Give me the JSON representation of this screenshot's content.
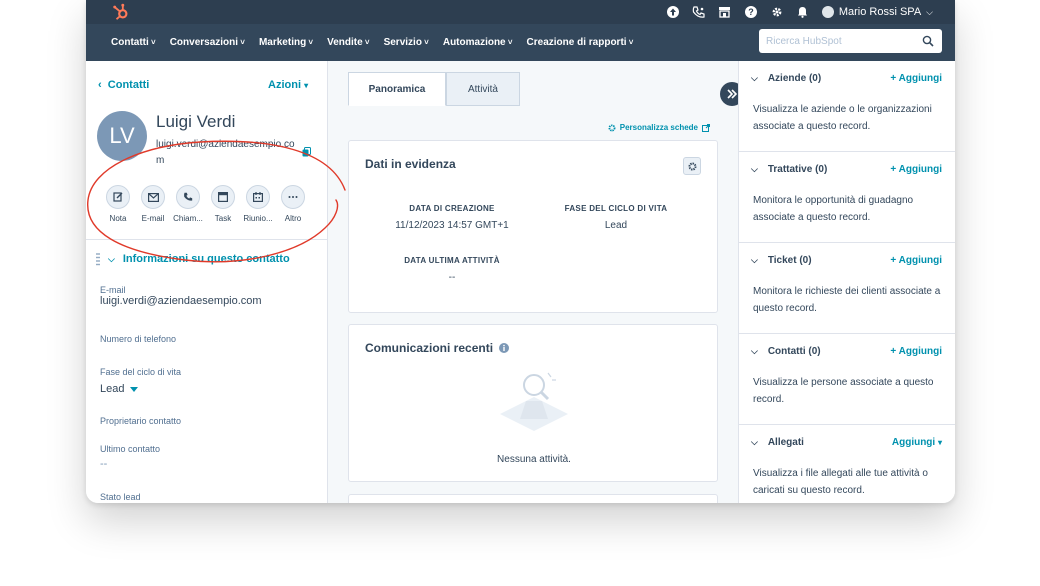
{
  "topbar": {
    "account_name": "Mario Rossi SPA",
    "icons": [
      "upgrade-icon",
      "calling-icon",
      "marketplace-icon",
      "help-icon",
      "settings-icon",
      "notifications-icon"
    ]
  },
  "nav": {
    "items": [
      "Contatti",
      "Conversazioni",
      "Marketing",
      "Vendite",
      "Servizio",
      "Automazione",
      "Creazione di rapporti"
    ],
    "search_placeholder": "Ricerca HubSpot"
  },
  "contact": {
    "back_label": "Contatti",
    "actions_label": "Azioni",
    "initials": "LV",
    "name": "Luigi Verdi",
    "email": "luigi.verdi@aziendaesempio.com",
    "quick_actions": [
      {
        "label": "Nota",
        "icon": "note-icon"
      },
      {
        "label": "E-mail",
        "icon": "email-icon"
      },
      {
        "label": "Chiam...",
        "icon": "phone-icon"
      },
      {
        "label": "Task",
        "icon": "task-icon"
      },
      {
        "label": "Riunio...",
        "icon": "meeting-icon"
      },
      {
        "label": "Altro",
        "icon": "more-icon"
      }
    ],
    "section_title": "Informazioni su questo contatto",
    "fields": [
      {
        "label": "E-mail",
        "value": "luigi.verdi@aziendaesempio.com"
      },
      {
        "label": "Numero di telefono",
        "value": ""
      },
      {
        "label": "Fase del ciclo di vita",
        "value": "Lead"
      },
      {
        "label": "Proprietario contatto",
        "value": ""
      },
      {
        "label": "Ultimo contatto",
        "value": "--"
      },
      {
        "label": "Stato lead",
        "value": ""
      }
    ]
  },
  "center": {
    "tabs": [
      "Panoramica",
      "Attività"
    ],
    "personalize_label": "Personalizza schede",
    "highlights": {
      "title": "Dati in evidenza",
      "items": [
        {
          "label": "DATA DI CREAZIONE",
          "value": "11/12/2023 14:57 GMT+1"
        },
        {
          "label": "FASE DEL CICLO DI VITA",
          "value": "Lead"
        },
        {
          "label": "DATA ULTIMA ATTIVITÀ",
          "value": "--"
        }
      ]
    },
    "recent": {
      "title": "Comunicazioni recenti",
      "empty": "Nessuna attività."
    }
  },
  "sidebar": {
    "sections": [
      {
        "title": "Aziende (0)",
        "add": "+ Aggiungi",
        "desc": "Visualizza le aziende o le organizzazioni associate a questo record."
      },
      {
        "title": "Trattative (0)",
        "add": "+ Aggiungi",
        "desc": "Monitora le opportunità di guadagno associate a questo record."
      },
      {
        "title": "Ticket (0)",
        "add": "+ Aggiungi",
        "desc": "Monitora le richieste dei clienti associate a questo record."
      },
      {
        "title": "Contatti (0)",
        "add": "+ Aggiungi",
        "desc": "Visualizza le persone associate a questo record."
      },
      {
        "title": "Allegati",
        "add": "Aggiungi",
        "desc": "Visualizza i file allegati alle tue attività o caricati su questo record."
      }
    ]
  },
  "colors": {
    "topbar": "#2d3e50",
    "navbar": "#33475b",
    "link": "#0091ae",
    "logo": "#ff7a59",
    "annotation": "#e03a2a"
  }
}
